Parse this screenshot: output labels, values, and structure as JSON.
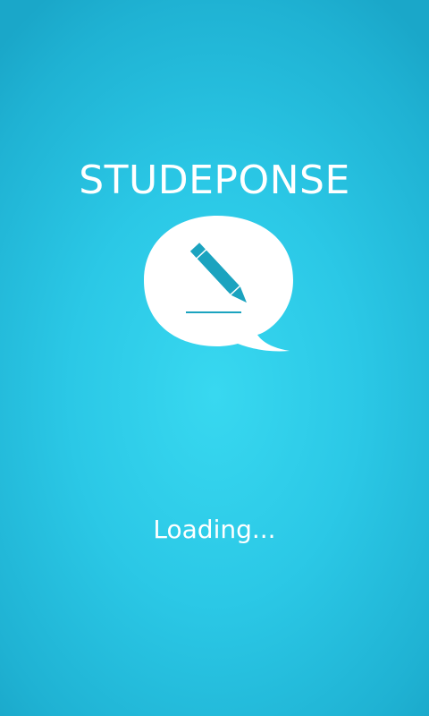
{
  "splash": {
    "title": "STUDEPONSE",
    "loading_text": "Loading...",
    "logo_icon": "speech-bubble-pencil-icon"
  },
  "colors": {
    "background_center": "#38d8f0",
    "background_edge": "#1aa7c9",
    "text": "#ffffff",
    "pencil": "#1ba3bf",
    "bubble": "#ffffff"
  }
}
